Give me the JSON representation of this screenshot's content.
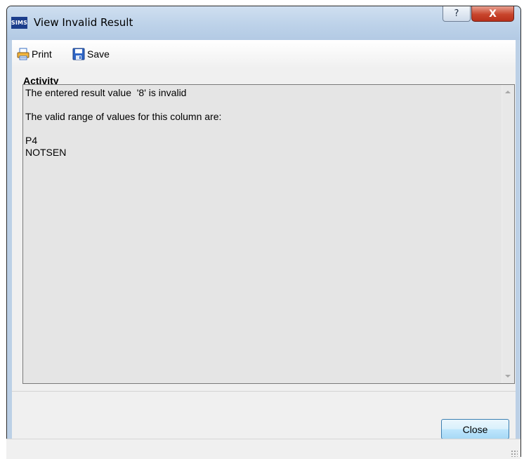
{
  "window": {
    "app_icon_text": "SIMS",
    "title": "View Invalid Result",
    "help_glyph": "?",
    "close_glyph": "X"
  },
  "toolbar": {
    "print_label": "Print",
    "print_icon": "printer-icon",
    "save_label": "Save",
    "save_icon": "floppy-disk-icon"
  },
  "activity": {
    "label": "Activity",
    "lines": [
      "The entered result value  '8' is invalid",
      "",
      "The valid range of values for this column are:",
      "",
      "P4",
      "NOTSEN"
    ]
  },
  "footer": {
    "close_label": "Close"
  },
  "colors": {
    "titlebar": "#bdd2e9",
    "close_red": "#c8452c",
    "textbox_bg": "#e5e5e5",
    "button_blue": "#3c7fb1"
  }
}
